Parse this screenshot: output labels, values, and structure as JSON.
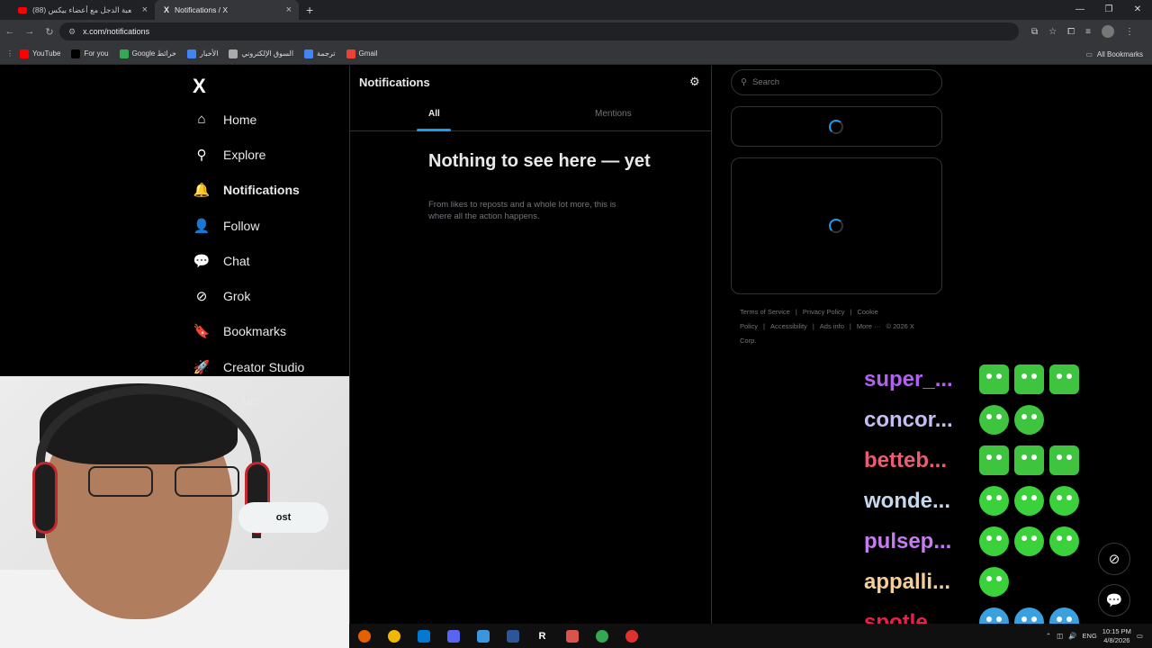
{
  "browser": {
    "tabs": [
      {
        "title": "لعبة الدجل مع أعضاء بيكس (88)",
        "close": "×"
      },
      {
        "title": "Notifications / X",
        "close": "×"
      }
    ],
    "new_tab": "+",
    "url": "x.com/notifications",
    "bookmarks": [
      "YouTube",
      "For you",
      "Google خرائط",
      "الأخبار",
      "السوق الإلكتروني",
      "ترجمة",
      "Gmail"
    ],
    "bookmark_colors": [
      "#ff0000",
      "#000000",
      "#34a853",
      "#4285f4",
      "#aaaaaa",
      "#4285f4",
      "#ea4335"
    ],
    "all_bookmarks": "All Bookmarks"
  },
  "sidebar": {
    "logo": "X",
    "items": [
      {
        "label": "Home",
        "icon": "home-icon",
        "glyph": "⌂"
      },
      {
        "label": "Explore",
        "icon": "search-icon",
        "glyph": "⚲"
      },
      {
        "label": "Notifications",
        "icon": "bell-icon",
        "glyph": "🔔"
      },
      {
        "label": "Follow",
        "icon": "follow-icon",
        "glyph": "👤"
      },
      {
        "label": "Chat",
        "icon": "chat-icon",
        "glyph": "💬"
      },
      {
        "label": "Grok",
        "icon": "grok-icon",
        "glyph": "⊘"
      },
      {
        "label": "Bookmarks",
        "icon": "bookmark-icon",
        "glyph": "🔖"
      },
      {
        "label": "Creator Studio",
        "icon": "rocket-icon",
        "glyph": "🚀"
      }
    ],
    "partial_item": "um",
    "post_button": "ost"
  },
  "main": {
    "title": "Notifications",
    "tabs": [
      "All",
      "Mentions"
    ],
    "empty_title": "Nothing to see here — yet",
    "empty_sub": "From likes to reposts and a whole lot more, this is where all the action happens."
  },
  "right": {
    "search_placeholder": "Search",
    "footer": [
      "Terms of Service",
      "|",
      "Privacy Policy",
      "|",
      "Cookie Policy",
      "|",
      "Accessibility",
      "|",
      "Ads info",
      "|",
      "More ···",
      "© 2026 X Corp."
    ]
  },
  "chat_overlay": [
    {
      "user": "super_...",
      "color": "#b362f0",
      "emotes": 3,
      "emote_color": "#3fc43f"
    },
    {
      "user": "concor...",
      "color": "#c8bdf2",
      "emotes": 2,
      "emote_color": "#3fc43f"
    },
    {
      "user": "betteb...",
      "color": "#e85d6f",
      "emotes": 3,
      "emote_color": "#3fc43f"
    },
    {
      "user": "wonde...",
      "color": "#c6d8ee",
      "emotes": 3,
      "emote_color": "#3ad13a"
    },
    {
      "user": "pulsep...",
      "color": "#c77bf0",
      "emotes": 3,
      "emote_color": "#3ad13a"
    },
    {
      "user": "appalli...",
      "color": "#f4cf98",
      "emotes": 1,
      "emote_color": "#3ad13a"
    },
    {
      "user": "spotle...",
      "color": "#e8214a",
      "emotes": 3,
      "emote_color": "#3aa0e0"
    }
  ],
  "taskbar": {
    "icon_colors": [
      "#e66000",
      "#f2b705",
      "#0078d4",
      "#5865f2",
      "#3a96dd",
      "#2b579a",
      "#222222",
      "#d9534f",
      "#34a853",
      "#e03030"
    ],
    "r_label": "R",
    "lang": "ENG",
    "time": "10:15 PM",
    "date": "4/8/2026"
  }
}
